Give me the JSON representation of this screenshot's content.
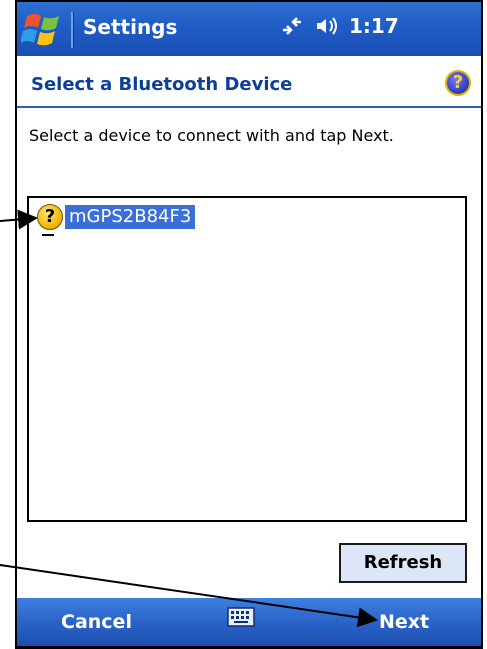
{
  "titlebar": {
    "app_title": "Settings",
    "clock": "1:17",
    "status_icons": [
      "connectivity-icon",
      "volume-icon"
    ]
  },
  "header": {
    "page_title": "Select a Bluetooth Device",
    "help_icon": "help-icon"
  },
  "instruction": "Select a device to connect with and tap Next.",
  "device_list": {
    "items": [
      {
        "name": "mGPS2B84F3",
        "icon": "unknown-device-icon",
        "selected": true
      }
    ]
  },
  "buttons": {
    "refresh_label": "Refresh"
  },
  "softkeys": {
    "left_label": "Cancel",
    "right_label": "Next",
    "center_icon": "keyboard-icon"
  },
  "colors": {
    "titlebar_blue": "#1f5cc6",
    "header_title_blue": "#0b3f9c",
    "selection_blue": "#3a6fd8",
    "softkey_blue": "#2a63c9"
  }
}
